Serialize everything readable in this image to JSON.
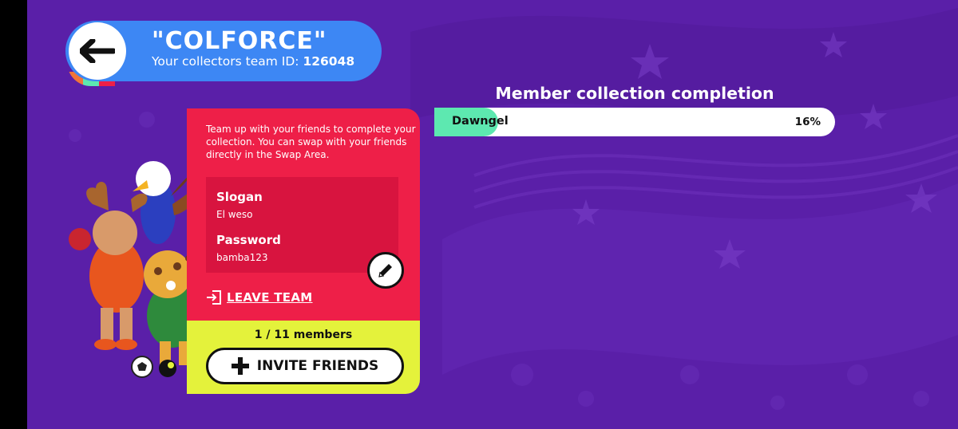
{
  "header": {
    "title": "\"COLFORCE\"",
    "team_id_label": "Your collectors team ID:",
    "team_id": "126048"
  },
  "card": {
    "description": "Team up with your friends to complete your collection. You can swap with your friends directly in the Swap Area.",
    "slogan_label": "Slogan",
    "slogan_value": "El weso",
    "password_label": "Password",
    "password_value": "bamba123",
    "leave_label": "LEAVE TEAM"
  },
  "members": {
    "count": "1 / 11 members",
    "invite_label": "INVITE FRIENDS"
  },
  "completion": {
    "title": "Member collection completion",
    "rows": [
      {
        "name": "Dawngel",
        "percent_label": "16%",
        "percent": 16
      }
    ]
  },
  "icons": {
    "back": "arrow-left-icon",
    "edit": "pencil-icon",
    "leave": "exit-icon",
    "invite": "plus-icon"
  },
  "colors": {
    "background": "#5a1fa8",
    "header": "#3d87f4",
    "card_red": "#ee1f48",
    "card_yellow": "#e4f23b",
    "progress": "#5de8b0"
  }
}
